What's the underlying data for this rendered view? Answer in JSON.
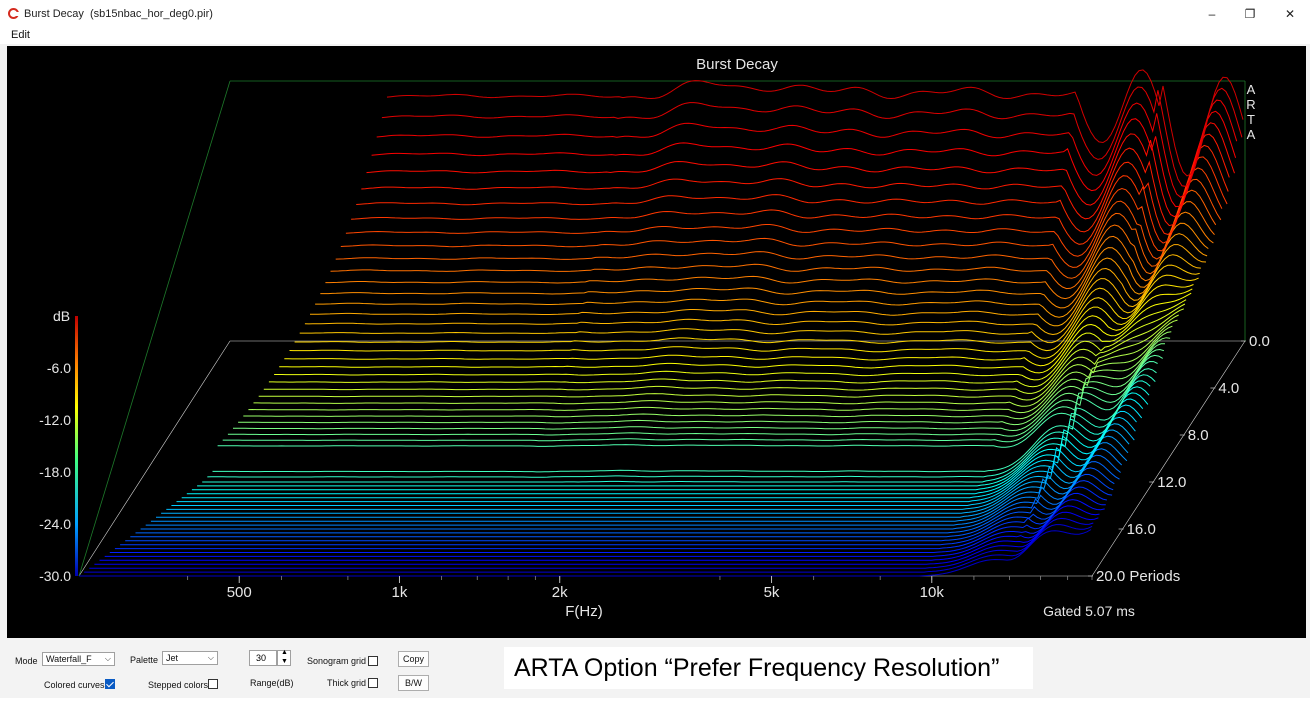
{
  "window": {
    "title": "Burst Decay  (sb15nbac_hor_deg0.pir)",
    "controls": {
      "minimize": "–",
      "restore": "❐",
      "close": "✕"
    }
  },
  "menu": {
    "items": [
      "Edit"
    ]
  },
  "chart_data": {
    "type": "waterfall",
    "title": "Burst Decay",
    "logo": "ARTA",
    "xlabel": "F(Hz)",
    "ylabel": "dB",
    "zlabel": "Periods",
    "x_scale": "log",
    "x_ticks": [
      "500",
      "1k",
      "2k",
      "5k",
      "10k"
    ],
    "y_ticks": [
      "-6.0",
      "-12.0",
      "-18.0",
      "-24.0",
      "-30.0"
    ],
    "z_ticks": [
      "0.0",
      "4.0",
      "8.0",
      "12.0",
      "16.0",
      "20.0 Periods"
    ],
    "ylim": [
      -30,
      0
    ],
    "zlim": [
      0,
      20
    ],
    "colormap": "Jet",
    "gated_note": "Gated 5.07 ms"
  },
  "controls": {
    "mode_label": "Mode",
    "mode_value": "Waterfall_F",
    "palette_label": "Palette",
    "palette_value": "Jet",
    "range_value": "30",
    "range_label": "Range(dB)",
    "sonogram_grid_label": "Sonogram grid",
    "thick_grid_label": "Thick grid",
    "colored_curves_label": "Colored curves",
    "stepped_colors_label": "Stepped colors",
    "copy_label": "Copy",
    "bw_label": "B/W"
  },
  "caption": "ARTA Option “Prefer Frequency Resolution”"
}
